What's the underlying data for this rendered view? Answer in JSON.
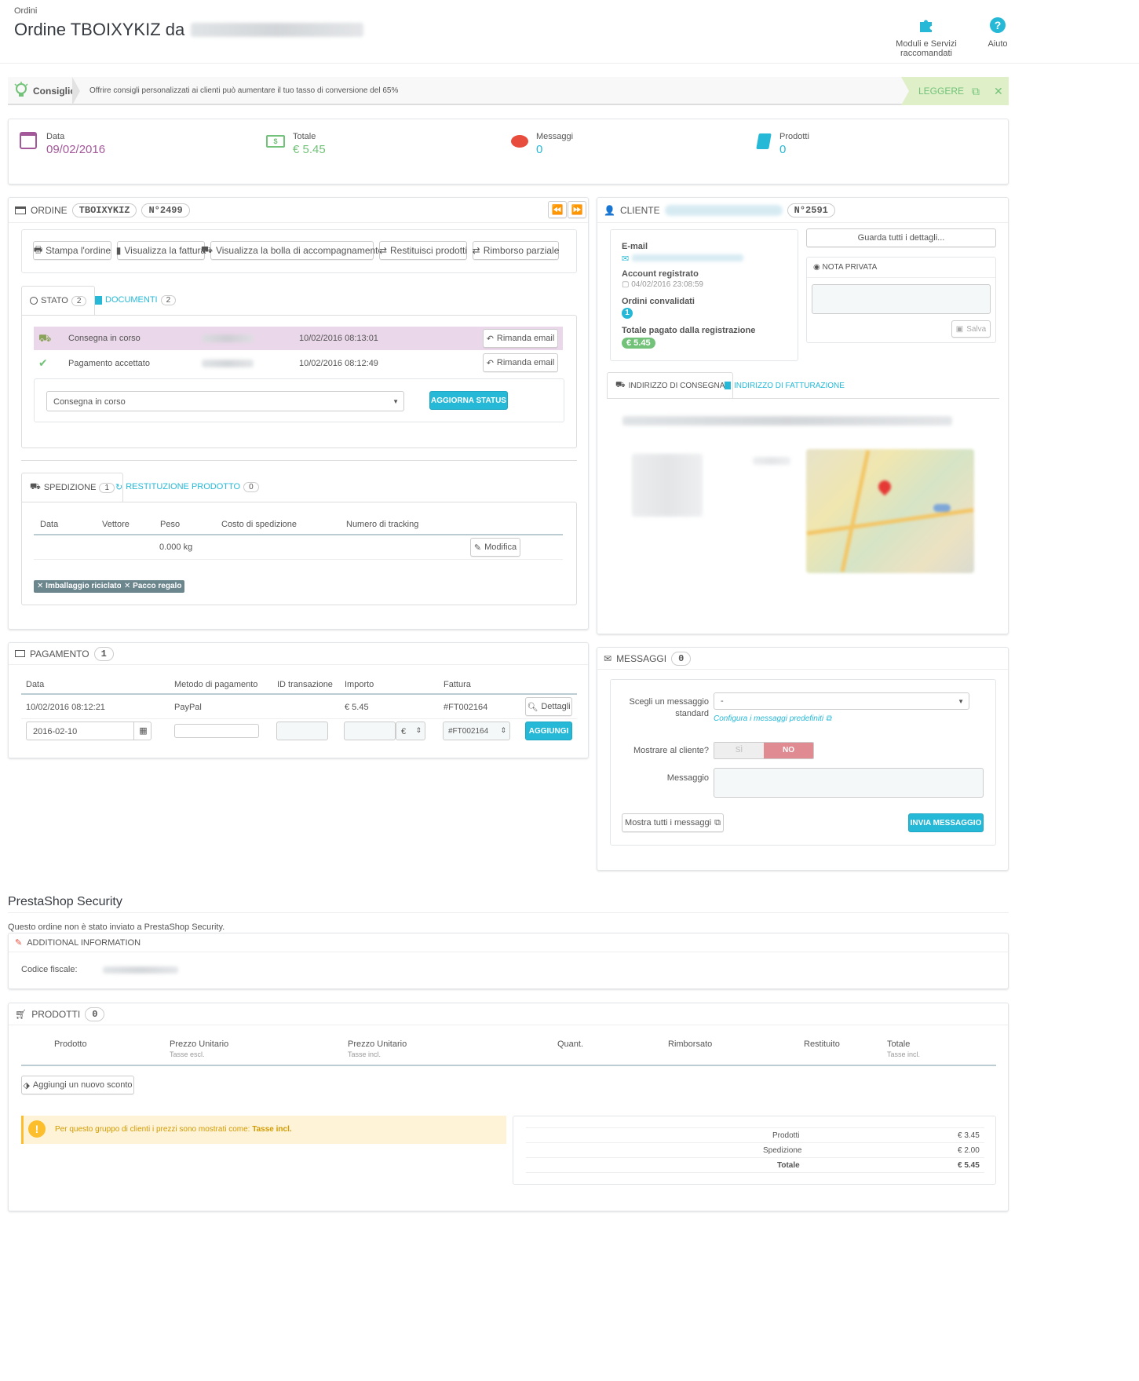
{
  "header": {
    "breadcrumb": "Ordini",
    "title": "Ordine TBOIXYKIZ da",
    "modules_label": "Moduli e Servizi raccomandati",
    "help_label": "Aiuto"
  },
  "tip": {
    "label": "Consiglio",
    "text": "Offrire consigli personalizzati ai clienti può aumentare il tuo tasso di conversione del 65%",
    "read_label": "LEGGERE"
  },
  "kpi": [
    {
      "label": "Data",
      "value": "09/02/2016",
      "color": "#a3589a",
      "icon": "calendar-icon"
    },
    {
      "label": "Totale",
      "value": "€ 5.45",
      "color": "#72c279",
      "icon": "money-icon"
    },
    {
      "label": "Messaggi",
      "value": "0",
      "color": "#25b9d7",
      "icon": "comments-icon"
    },
    {
      "label": "Prodotti",
      "value": "0",
      "color": "#25b9d7",
      "icon": "book-icon"
    }
  ],
  "order": {
    "label": "ORDINE",
    "reference": "TBOIXYKIZ",
    "number": "N°2499",
    "actions": [
      "Stampa l'ordine",
      "Visualizza la fattura",
      "Visualizza la bolla di accompagnamento",
      "Restituisci prodotti",
      "Rimborso parziale"
    ],
    "tab_status": "STATO",
    "tab_status_count": "2",
    "tab_documents": "DOCUMENTI",
    "tab_documents_count": "2",
    "history": [
      {
        "status": "Consegna in corso",
        "date": "10/02/2016 08:13:01",
        "action": "Rimanda email"
      },
      {
        "status": "Pagamento accettato",
        "date": "10/02/2016 08:12:49",
        "action": "Rimanda email"
      }
    ],
    "status_select": "Consegna in corso",
    "update_status_label": "AGGIORNA STATUS"
  },
  "shipping": {
    "tab_shipping": "SPEDIZIONE",
    "tab_shipping_count": "1",
    "tab_return": "RESTITUZIONE PRODOTTO",
    "tab_return_count": "0",
    "columns": [
      "Data",
      "Vettore",
      "Peso",
      "Costo di spedizione",
      "Numero di tracking"
    ],
    "weight": "0.000 kg",
    "edit_label": "Modifica",
    "tags": [
      "Imballaggio riciclato",
      "Pacco regalo"
    ]
  },
  "customer": {
    "label": "CLIENTE",
    "number": "N°2591",
    "email_label": "E-mail",
    "registered_label": "Account registrato",
    "registered_value": "04/02/2016 23:08:59",
    "valid_orders_label": "Ordini convalidati",
    "valid_orders_value": "1",
    "total_paid_label": "Totale pagato dalla registrazione",
    "total_paid_value": "€ 5.45",
    "details_button": "Guarda tutti i dettagli...",
    "private_note_label": "NOTA PRIVATA",
    "save_label": "Salva",
    "tab_delivery": "INDIRIZZO DI CONSEGNA",
    "tab_invoice": "INDIRIZZO DI FATTURAZIONE"
  },
  "payment": {
    "label": "PAGAMENTO",
    "count": "1",
    "columns": [
      "Data",
      "Metodo di pagamento",
      "ID transazione",
      "Importo",
      "Fattura"
    ],
    "row": {
      "date": "10/02/2016 08:12:21",
      "method": "PayPal",
      "amount": "€ 5.45",
      "invoice": "#FT002164"
    },
    "details_label": "Dettagli",
    "input_date": "2016-02-10",
    "currency": "€",
    "invoice_select": "#FT002164",
    "add_label": "AGGIUNGI"
  },
  "messages": {
    "label": "MESSAGGI",
    "count": "0",
    "choose_label": "Scegli un messaggio standard",
    "choose_value": "-",
    "configure_link": "Configura i messaggi predefiniti",
    "show_customer_label": "Mostrare al cliente?",
    "yes": "SÌ",
    "no": "NO",
    "message_label": "Messaggio",
    "show_all": "Mostra tutti i messaggi",
    "send_label": "INVIA MESSAGGIO"
  },
  "security": {
    "title": "PrestaShop Security",
    "note": "Questo ordine non è stato inviato a PrestaShop Security."
  },
  "additional": {
    "label": "ADDITIONAL INFORMATION",
    "tax_code_label": "Codice fiscale:"
  },
  "products": {
    "label": "PRODOTTI",
    "count": "0",
    "columns": [
      {
        "title": "Prodotto",
        "sub": ""
      },
      {
        "title": "Prezzo Unitario",
        "sub": "Tasse escl."
      },
      {
        "title": "Prezzo Unitario",
        "sub": "Tasse incl."
      },
      {
        "title": "Quant.",
        "sub": ""
      },
      {
        "title": "Rimborsato",
        "sub": ""
      },
      {
        "title": "Restituito",
        "sub": ""
      },
      {
        "title": "Totale",
        "sub": "Tasse incl."
      }
    ],
    "add_discount": "Aggiungi un nuovo sconto",
    "warning_text": "Per questo gruppo di clienti i prezzi sono mostrati come:",
    "warning_strong": "Tasse incl.",
    "totals": [
      {
        "label": "Prodotti",
        "value": "€ 3.45"
      },
      {
        "label": "Spedizione",
        "value": "€ 2.00"
      },
      {
        "label": "Totale",
        "value": "€ 5.45"
      }
    ]
  }
}
